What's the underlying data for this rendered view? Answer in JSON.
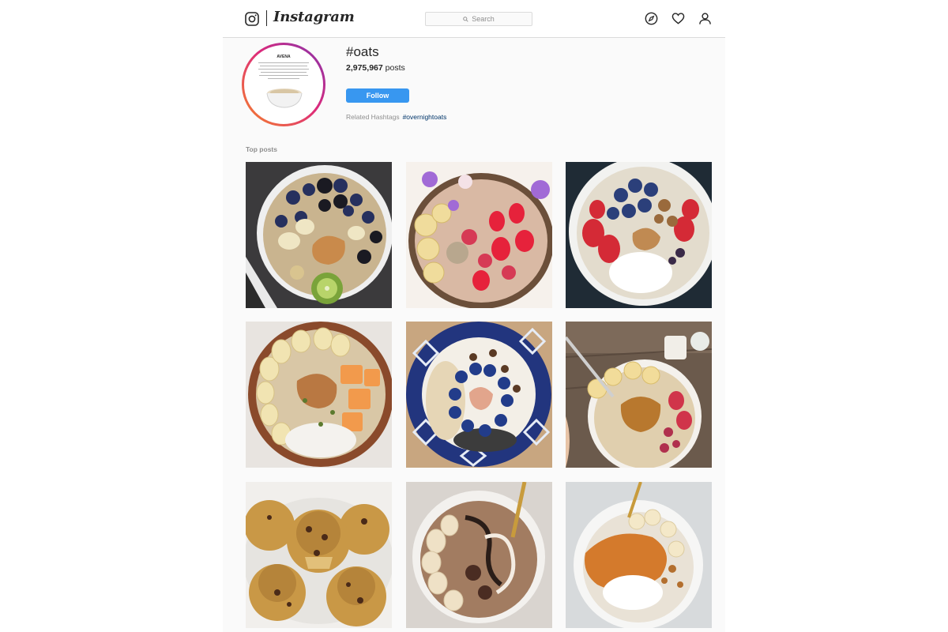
{
  "header": {
    "logo_text": "Instagram",
    "search_placeholder": "Search",
    "icons": [
      "instagram-camera-icon",
      "compass-icon",
      "heart-icon",
      "user-icon"
    ]
  },
  "hashtag": {
    "avatar_title": "AVENA",
    "title": "#oats",
    "post_count": "2,975,967",
    "posts_label": " posts",
    "follow_label": "Follow",
    "related_label": "Related Hashtags",
    "related_tags": [
      "#overnightoats"
    ]
  },
  "top_posts": {
    "section_label": "Top posts",
    "tiles": [
      {
        "name": "oat-bowl-blueberries-kiwi"
      },
      {
        "name": "coconut-bowl-strawberries-banana"
      },
      {
        "name": "white-bowl-berries-yogurt"
      },
      {
        "name": "wooden-bowl-banana-melon"
      },
      {
        "name": "blue-pattern-bowl-blueberries"
      },
      {
        "name": "oatmeal-peanut-butter-banana"
      },
      {
        "name": "oat-muffins-chocolate-chips"
      },
      {
        "name": "chocolate-oats-banana-swirl"
      },
      {
        "name": "caramel-oats-granola-yogurt"
      }
    ]
  },
  "colors": {
    "accent": "#3897f0",
    "tag_link": "#003569",
    "muted": "#8e8e8e"
  }
}
